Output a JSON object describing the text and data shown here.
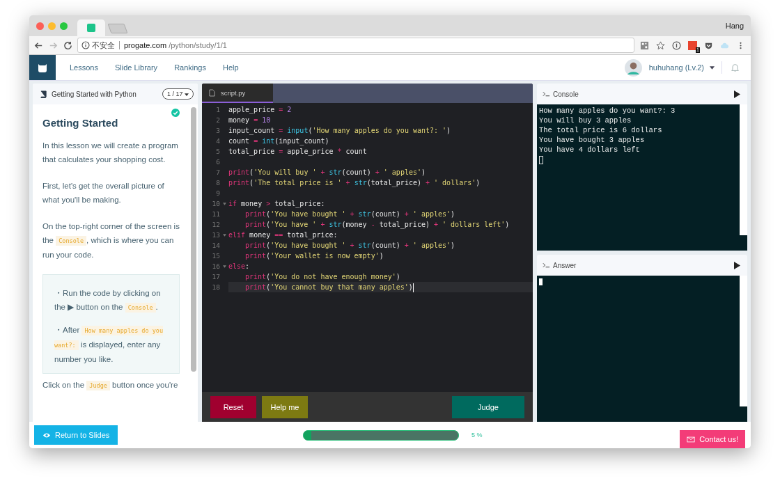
{
  "browser": {
    "profile": "Hang",
    "security": "不安全",
    "host": "progate.com",
    "path": "/python/study/1/1",
    "extension_badge": "1"
  },
  "nav": {
    "links": [
      "Lessons",
      "Slide Library",
      "Rankings",
      "Help"
    ],
    "user": "huhuhang (Lv.2)"
  },
  "lesson": {
    "course": "Getting Started with Python",
    "page": "1 / 17",
    "completed": true,
    "title": "Getting Started",
    "paragraphs": [
      [
        {
          "kind": "text",
          "text": "In this lesson we will create a program that calculates your shopping cost."
        }
      ],
      [
        {
          "kind": "text",
          "text": "First, let's get the overall picture of what you'll be making."
        }
      ],
      [
        {
          "kind": "text",
          "text": "On the top-right corner of the screen is the "
        },
        {
          "kind": "code",
          "text": "Console"
        },
        {
          "kind": "text",
          "text": ", which is where you can run your code."
        }
      ]
    ],
    "hints": [
      [
        {
          "kind": "text",
          "text": "・Run the code by clicking on the ▶ button on the "
        },
        {
          "kind": "code",
          "text": "Console"
        },
        {
          "kind": "text",
          "text": "."
        }
      ],
      [
        {
          "kind": "text",
          "text": "・After "
        },
        {
          "kind": "code",
          "text": "How many apples do you want?:"
        },
        {
          "kind": "text",
          "text": " is displayed, enter any number you like."
        }
      ]
    ],
    "closing": [
      {
        "kind": "text",
        "text": "Click on the "
      },
      {
        "kind": "code",
        "text": "Judge"
      },
      {
        "kind": "text",
        "text": " button once you're"
      }
    ]
  },
  "editor": {
    "file": "script.py",
    "lines": [
      {
        "number": "1",
        "indent": false,
        "fold": false,
        "active": false,
        "tokens": [
          {
            "t": "apple_price ",
            "kind": "id"
          },
          {
            "t": "= ",
            "kind": "op"
          },
          {
            "t": "2",
            "kind": "num"
          }
        ]
      },
      {
        "number": "2",
        "indent": false,
        "fold": false,
        "active": false,
        "tokens": [
          {
            "t": "money ",
            "kind": "id"
          },
          {
            "t": "= ",
            "kind": "op"
          },
          {
            "t": "10",
            "kind": "num"
          }
        ]
      },
      {
        "number": "3",
        "indent": false,
        "fold": false,
        "active": false,
        "tokens": [
          {
            "t": "input_count ",
            "kind": "id"
          },
          {
            "t": "= ",
            "kind": "op"
          },
          {
            "t": "input",
            "kind": "fn"
          },
          {
            "t": "(",
            "kind": "id"
          },
          {
            "t": "'How many apples do you want?: '",
            "kind": "str"
          },
          {
            "t": ")",
            "kind": "id"
          }
        ]
      },
      {
        "number": "4",
        "indent": false,
        "fold": false,
        "active": false,
        "tokens": [
          {
            "t": "count ",
            "kind": "id"
          },
          {
            "t": "= ",
            "kind": "op"
          },
          {
            "t": "int",
            "kind": "fn"
          },
          {
            "t": "(input_count)",
            "kind": "id"
          }
        ]
      },
      {
        "number": "5",
        "indent": false,
        "fold": false,
        "active": false,
        "tokens": [
          {
            "t": "total_price ",
            "kind": "id"
          },
          {
            "t": "= ",
            "kind": "op"
          },
          {
            "t": "apple_price ",
            "kind": "id"
          },
          {
            "t": "* ",
            "kind": "op"
          },
          {
            "t": "count",
            "kind": "id"
          }
        ]
      },
      {
        "number": "6",
        "fold": false,
        "active": false
      },
      {
        "number": "7",
        "indent": false,
        "fold": false,
        "active": false,
        "tokens": [
          {
            "t": "print",
            "kind": "kw"
          },
          {
            "t": "(",
            "kind": "id"
          },
          {
            "t": "'You will buy '",
            "kind": "str"
          },
          {
            "t": " + ",
            "kind": "op"
          },
          {
            "t": "str",
            "kind": "fn"
          },
          {
            "t": "(count)",
            "kind": "id"
          },
          {
            "t": " + ",
            "kind": "op"
          },
          {
            "t": "' apples'",
            "kind": "str"
          },
          {
            "t": ")",
            "kind": "id"
          }
        ]
      },
      {
        "number": "8",
        "indent": false,
        "fold": false,
        "active": false,
        "tokens": [
          {
            "t": "print",
            "kind": "kw"
          },
          {
            "t": "(",
            "kind": "id"
          },
          {
            "t": "'The total price is '",
            "kind": "str"
          },
          {
            "t": " + ",
            "kind": "op"
          },
          {
            "t": "str",
            "kind": "fn"
          },
          {
            "t": "(total_price)",
            "kind": "id"
          },
          {
            "t": " + ",
            "kind": "op"
          },
          {
            "t": "' dollars'",
            "kind": "str"
          },
          {
            "t": ")",
            "kind": "id"
          }
        ]
      },
      {
        "number": "9",
        "fold": false,
        "active": false
      },
      {
        "number": "10",
        "indent": false,
        "fold": true,
        "active": false,
        "tokens": [
          {
            "t": "if ",
            "kind": "kw"
          },
          {
            "t": "money ",
            "kind": "id"
          },
          {
            "t": "> ",
            "kind": "op"
          },
          {
            "t": "total_price:",
            "kind": "id"
          }
        ]
      },
      {
        "number": "11",
        "indent": true,
        "fold": false,
        "active": false,
        "tokens": [
          {
            "t": "print",
            "kind": "kw"
          },
          {
            "t": "(",
            "kind": "id"
          },
          {
            "t": "'You have bought '",
            "kind": "str"
          },
          {
            "t": " + ",
            "kind": "op"
          },
          {
            "t": "str",
            "kind": "fn"
          },
          {
            "t": "(count)",
            "kind": "id"
          },
          {
            "t": " + ",
            "kind": "op"
          },
          {
            "t": "' apples'",
            "kind": "str"
          },
          {
            "t": ")",
            "kind": "id"
          }
        ]
      },
      {
        "number": "12",
        "indent": true,
        "fold": false,
        "active": false,
        "tokens": [
          {
            "t": "print",
            "kind": "kw"
          },
          {
            "t": "(",
            "kind": "id"
          },
          {
            "t": "'You have '",
            "kind": "str"
          },
          {
            "t": " + ",
            "kind": "op"
          },
          {
            "t": "str",
            "kind": "fn"
          },
          {
            "t": "(money ",
            "kind": "id"
          },
          {
            "t": "- ",
            "kind": "op"
          },
          {
            "t": "total_price)",
            "kind": "id"
          },
          {
            "t": " + ",
            "kind": "op"
          },
          {
            "t": "' dollars left'",
            "kind": "str"
          },
          {
            "t": ")",
            "kind": "id"
          }
        ]
      },
      {
        "number": "13",
        "indent": false,
        "fold": true,
        "active": false,
        "tokens": [
          {
            "t": "elif ",
            "kind": "kw"
          },
          {
            "t": "money ",
            "kind": "id"
          },
          {
            "t": "== ",
            "kind": "op"
          },
          {
            "t": "total_price:",
            "kind": "id"
          }
        ]
      },
      {
        "number": "14",
        "indent": true,
        "fold": false,
        "active": false,
        "tokens": [
          {
            "t": "print",
            "kind": "kw"
          },
          {
            "t": "(",
            "kind": "id"
          },
          {
            "t": "'You have bought '",
            "kind": "str"
          },
          {
            "t": " + ",
            "kind": "op"
          },
          {
            "t": "str",
            "kind": "fn"
          },
          {
            "t": "(count)",
            "kind": "id"
          },
          {
            "t": " + ",
            "kind": "op"
          },
          {
            "t": "' apples'",
            "kind": "str"
          },
          {
            "t": ")",
            "kind": "id"
          }
        ]
      },
      {
        "number": "15",
        "indent": true,
        "fold": false,
        "active": false,
        "tokens": [
          {
            "t": "print",
            "kind": "kw"
          },
          {
            "t": "(",
            "kind": "id"
          },
          {
            "t": "'Your wallet is now empty'",
            "kind": "str"
          },
          {
            "t": ")",
            "kind": "id"
          }
        ]
      },
      {
        "number": "16",
        "indent": false,
        "fold": true,
        "active": false,
        "tokens": [
          {
            "t": "else",
            "kind": "kw"
          },
          {
            "t": ":",
            "kind": "id"
          }
        ]
      },
      {
        "number": "17",
        "indent": true,
        "fold": false,
        "active": false,
        "tokens": [
          {
            "t": "print",
            "kind": "kw"
          },
          {
            "t": "(",
            "kind": "id"
          },
          {
            "t": "'You do not have enough money'",
            "kind": "str"
          },
          {
            "t": ")",
            "kind": "id"
          }
        ]
      },
      {
        "number": "18",
        "indent": true,
        "fold": false,
        "active": true,
        "tokens": [
          {
            "t": "print",
            "kind": "kw"
          },
          {
            "t": "(",
            "kind": "id"
          },
          {
            "t": "'You cannot buy that many apples'",
            "kind": "str"
          },
          {
            "t": ")",
            "kind": "id"
          }
        ]
      }
    ]
  },
  "buttons": {
    "reset": "Reset",
    "help": "Help me",
    "judge": "Judge"
  },
  "console": {
    "title": "Console",
    "output": [
      "How many apples do you want?: 3",
      "You will buy 3 apples",
      "The total price is 6 dollars",
      "You have bought 3 apples",
      "You have 4 dollars left"
    ]
  },
  "answer": {
    "title": "Answer"
  },
  "footer": {
    "return": "Return to Slides",
    "progress": {
      "level": 0.05,
      "reading": "5 %"
    },
    "contact": "Contact us!"
  }
}
